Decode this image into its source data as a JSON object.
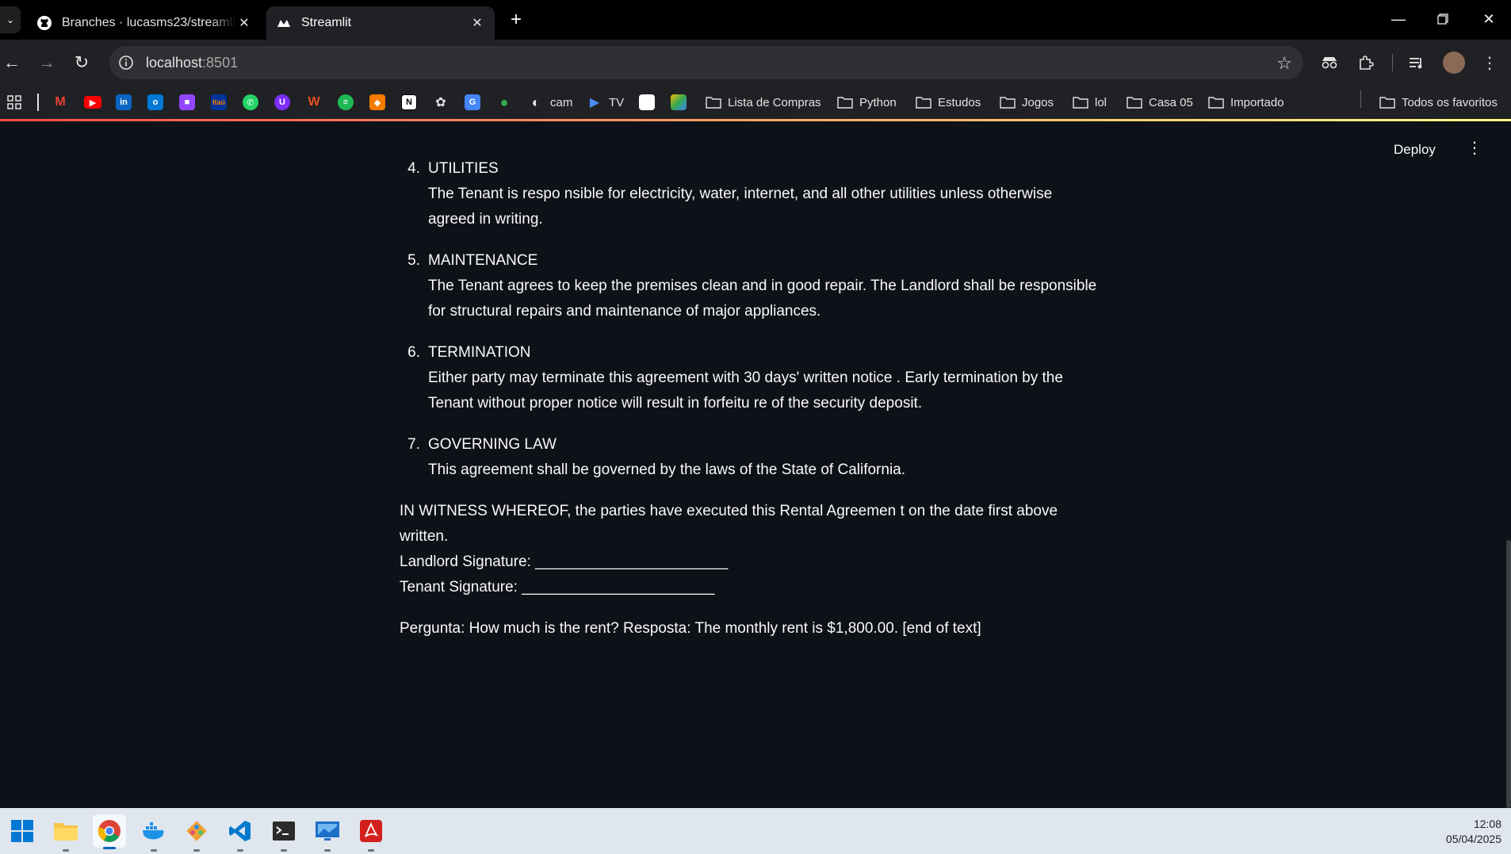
{
  "browser": {
    "tabs": [
      {
        "title": "Branches · lucasms23/streamlit-",
        "icon": "github-icon",
        "active": false
      },
      {
        "title": "Streamlit",
        "icon": "streamlit-icon",
        "active": true
      }
    ],
    "new_tab_symbol": "+",
    "url_host": "localhost",
    "url_port": ":8501",
    "bookmarks": [
      {
        "icon": "gmail-icon",
        "label": ""
      },
      {
        "icon": "youtube-icon",
        "label": ""
      },
      {
        "icon": "linkedin-icon",
        "label": ""
      },
      {
        "icon": "outlook-icon",
        "label": ""
      },
      {
        "icon": "twitch-icon",
        "label": ""
      },
      {
        "icon": "itau-icon",
        "label": ""
      },
      {
        "icon": "whatsapp-icon",
        "label": ""
      },
      {
        "icon": "vpn-icon",
        "label": ""
      },
      {
        "icon": "w-icon",
        "label": ""
      },
      {
        "icon": "spotify-icon",
        "label": ""
      },
      {
        "icon": "orange-box-icon",
        "label": ""
      },
      {
        "icon": "notion-icon",
        "label": ""
      },
      {
        "icon": "openai-icon",
        "label": ""
      },
      {
        "icon": "translate-icon",
        "label": ""
      },
      {
        "icon": "maps-icon",
        "label": ""
      },
      {
        "icon": "globe-icon",
        "label": "cam"
      },
      {
        "icon": "tv-play-icon",
        "label": "TV"
      }
    ],
    "folders": [
      "Lista de Compras",
      "Python",
      "Estudos",
      "Jogos",
      "lol",
      "Casa 05",
      "Importado"
    ],
    "all_bookmarks_label": "Todos os favoritos"
  },
  "app": {
    "deploy_label": "Deploy",
    "clauses": [
      {
        "number": "4.",
        "heading": "UTILITIES",
        "body": "The Tenant is respo nsible for electricity, water, internet, and all other utilities unless otherwise agreed in writing."
      },
      {
        "number": "5.",
        "heading": "MAINTENANCE",
        "body": "The Tenant agrees to keep the premises clean and in good repair. The Landlord shall be responsible for structural repairs and maintenance of major appliances."
      },
      {
        "number": "6.",
        "heading": "TERMINATION",
        "body": "Either party may terminate this agreement with 30 days' written notice . Early termination by the Tenant without proper notice will result in forfeitu re of the security deposit."
      },
      {
        "number": "7.",
        "heading": "GOVERNING LAW",
        "body": "This agreement shall be governed by the laws of the State of California."
      }
    ],
    "witness": "IN WITNESS WHEREOF, the parties have executed this Rental Agreemen t on the date first above written.",
    "landlord_signature": "Landlord Signature: _______________________",
    "tenant_signature": "Tenant Signature: _______________________",
    "qa_text": "Pergunta: How much is the rent? Resposta: The monthly rent is $1,800.00. [end of text]"
  },
  "taskbar": {
    "apps": [
      "windows-start-icon",
      "file-explorer-icon",
      "chrome-icon",
      "docker-icon",
      "git-icon",
      "vscode-icon",
      "terminal-icon",
      "remote-desktop-icon",
      "acrobat-icon"
    ],
    "time": "12:08",
    "date": "05/04/2025"
  }
}
